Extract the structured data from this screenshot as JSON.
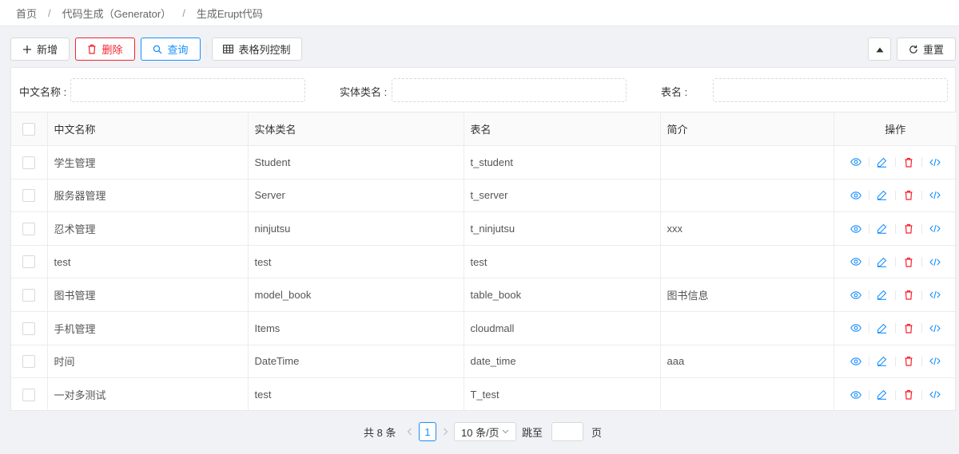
{
  "breadcrumb": {
    "home": "首页",
    "parent": "代码生成（Generator）",
    "current": "生成Erupt代码",
    "separator": "/"
  },
  "toolbar": {
    "add_label": "新增",
    "delete_label": "删除",
    "query_label": "查询",
    "columns_label": "表格列控制",
    "reset_label": "重置"
  },
  "search": {
    "name_label": "中文名称 :",
    "class_label": "实体类名 :",
    "table_label": "表名 :",
    "name_value": "",
    "class_value": "",
    "table_value": ""
  },
  "table": {
    "headers": {
      "name": "中文名称",
      "class": "实体类名",
      "table": "表名",
      "desc": "简介",
      "ops": "操作"
    },
    "rows": [
      {
        "name": "学生管理",
        "class": "Student",
        "table": "t_student",
        "desc": ""
      },
      {
        "name": "服务器管理",
        "class": "Server",
        "table": "t_server",
        "desc": ""
      },
      {
        "name": "忍术管理",
        "class": "ninjutsu",
        "table": "t_ninjutsu",
        "desc": "xxx"
      },
      {
        "name": "test",
        "class": "test",
        "table": "test",
        "desc": ""
      },
      {
        "name": "图书管理",
        "class": "model_book",
        "table": "table_book",
        "desc": "图书信息"
      },
      {
        "name": "手机管理",
        "class": "Items",
        "table": "cloudmall",
        "desc": ""
      },
      {
        "name": "时间",
        "class": "DateTime",
        "table": "date_time",
        "desc": "aaa"
      },
      {
        "name": "一对多测试",
        "class": "test",
        "table": "T_test",
        "desc": ""
      }
    ]
  },
  "pagination": {
    "total": "共 8 条",
    "current_page": "1",
    "page_size": "10 条/页",
    "jump_label": "跳至",
    "page_unit": "页",
    "jump_value": ""
  },
  "colors": {
    "primary": "#1890ff",
    "danger": "#f5222d",
    "border": "#d9d9d9"
  },
  "icons": {
    "view": "eye-icon",
    "edit": "edit-icon",
    "delete": "trash-icon",
    "code": "code-icon"
  }
}
